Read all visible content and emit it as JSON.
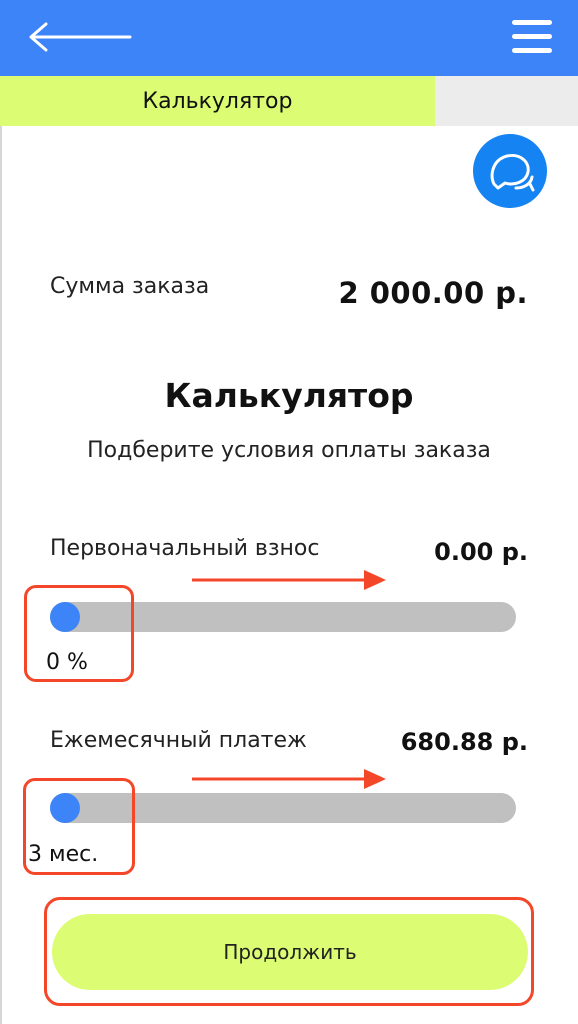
{
  "header": {
    "back_icon": "arrow-left-icon",
    "menu_icon": "hamburger-menu-icon",
    "background": "#3d84f8"
  },
  "tab": {
    "label": "Калькулятор",
    "accent": "#dcfc74"
  },
  "chat_button": {
    "icon": "chat-bubbles-icon",
    "color": "#1583f2"
  },
  "order": {
    "label": "Сумма заказа",
    "value": "2 000.00 р."
  },
  "calculator": {
    "title": "Калькулятор",
    "subtitle": "Подберите условия оплаты заказа"
  },
  "down_payment": {
    "label": "Первоначальный взнос",
    "value": "0.00 р.",
    "slider_fraction": 0,
    "slider_caption": "0 %"
  },
  "monthly_payment": {
    "label": "Ежемесячный платеж",
    "value": "680.88 р.",
    "slider_fraction": 0,
    "slider_caption": "3 мес."
  },
  "continue_button": {
    "label": "Продолжить"
  },
  "annotation_color": "#f4472a"
}
